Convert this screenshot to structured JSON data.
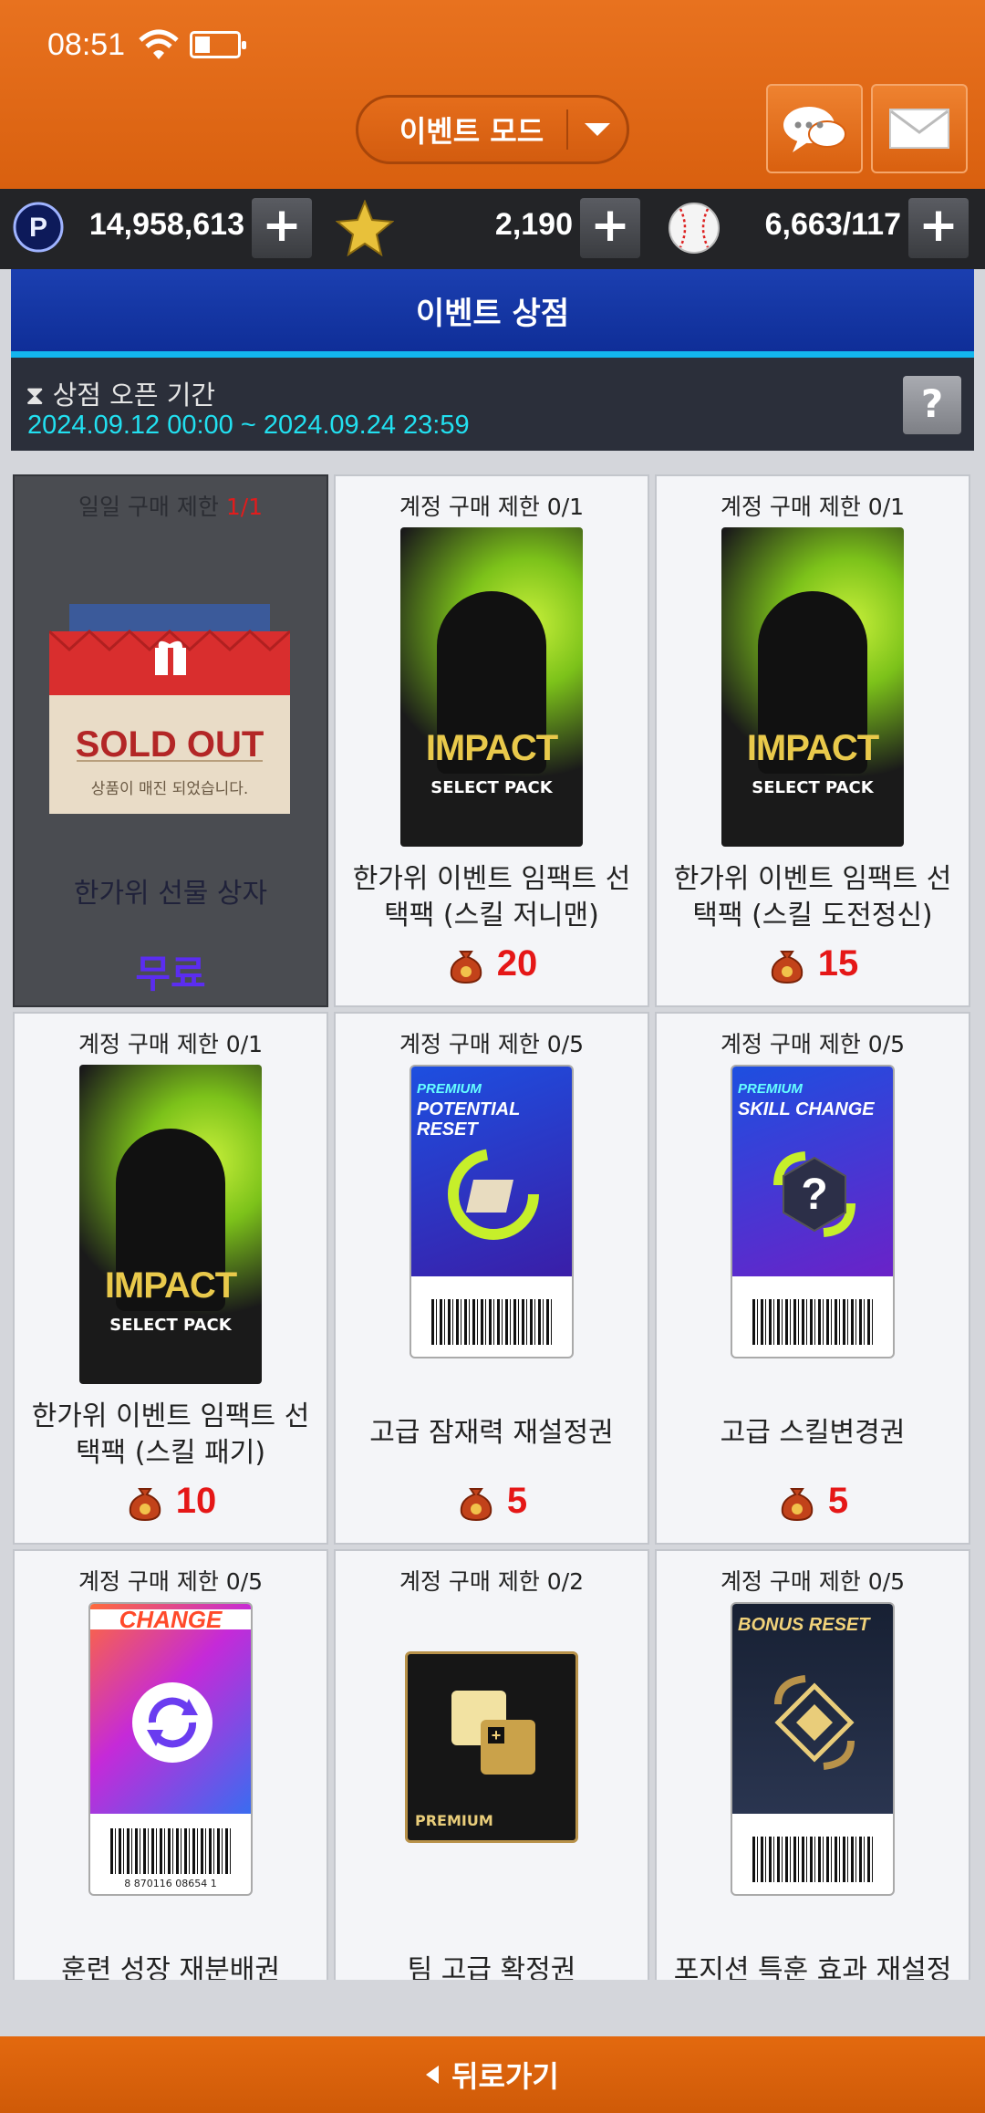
{
  "status": {
    "time": "08:51"
  },
  "header": {
    "mode_label": "이벤트 모드"
  },
  "currency": {
    "points": "14,958,613",
    "stars": "2,190",
    "balls": "6,663/117"
  },
  "shop": {
    "title": "이벤트 상점",
    "period_label": "상점 오픈 기간",
    "period": "2024.09.12 00:00 ~ 2024.09.24 23:59",
    "help": "?"
  },
  "items": [
    {
      "limit_prefix": "일일 구매 제한",
      "limit_count": "1/1",
      "name": "한가위 선물 상자",
      "price": "무료",
      "sold_out": "SOLD OUT",
      "sold_out_msg": "상품이 매진 되었습니다."
    },
    {
      "limit": "계정 구매 제한 0/1",
      "name": "한가위 이벤트 임팩트 선택팩 (스킬 저니맨)",
      "price": "20",
      "pack_title": "IMPACT",
      "pack_sub": "SELECT PACK"
    },
    {
      "limit": "계정 구매 제한 0/1",
      "name": "한가위 이벤트 임팩트 선택팩 (스킬 도전정신)",
      "price": "15",
      "pack_title": "IMPACT",
      "pack_sub": "SELECT PACK"
    },
    {
      "limit": "계정 구매 제한 0/1",
      "name": "한가위 이벤트 임팩트 선택팩 (스킬 패기)",
      "price": "10",
      "pack_title": "IMPACT",
      "pack_sub": "SELECT PACK"
    },
    {
      "limit": "계정 구매 제한 0/5",
      "name": "고급 잠재력 재설정권",
      "price": "5",
      "ticket_small": "PREMIUM",
      "ticket_title": "POTENTIAL RESET"
    },
    {
      "limit": "계정 구매 제한 0/5",
      "name": "고급 스킬변경권",
      "price": "5",
      "ticket_small": "PREMIUM",
      "ticket_title": "SKILL CHANGE"
    },
    {
      "limit": "계정 구매 제한 0/5",
      "name": "훈련 성장 재분배권",
      "ticket_title": "CHANGE",
      "barcode": "8 870116 08654 1"
    },
    {
      "limit": "계정 구매 제한 0/2",
      "name": "팀 고급 확정권",
      "ticket_title": "PREMIUM"
    },
    {
      "limit": "계정 구매 제한 0/5",
      "name": "포지션 특훈 효과 재설정권",
      "ticket_title": "BONUS RESET"
    }
  ],
  "footer": {
    "back_label": "뒤로가기"
  }
}
